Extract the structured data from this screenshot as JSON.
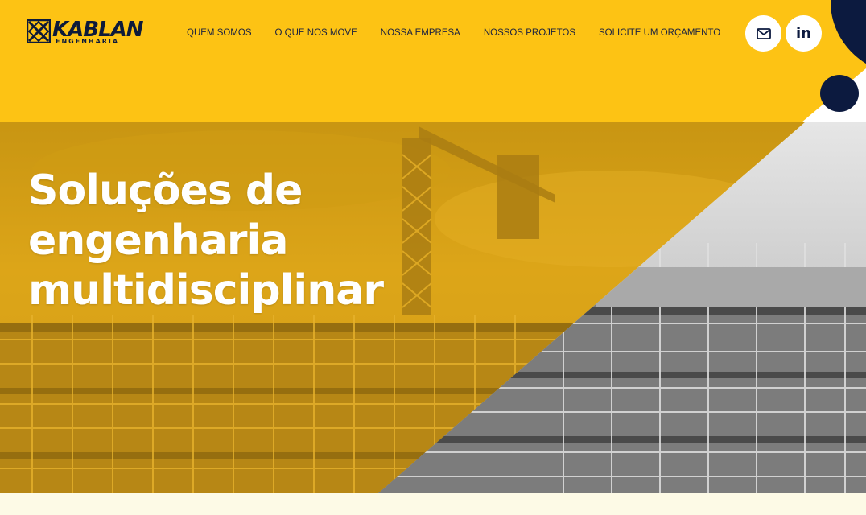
{
  "brand": {
    "name": "KABLAN",
    "tagline": "ENGENHARIA"
  },
  "nav": {
    "items": [
      "QUEM SOMOS",
      "O QUE NOS MOVE",
      "NOSSA EMPRESA",
      "NOSSOS PROJETOS",
      "SOLICITE UM ORÇAMENTO"
    ]
  },
  "social": {
    "email_icon": "envelope-icon",
    "linkedin_icon": "linkedin-icon",
    "linkedin_text": "in"
  },
  "hero": {
    "title_lines": [
      "Soluções de",
      "engenharia",
      "multidisciplinar"
    ]
  },
  "colors": {
    "brand_yellow": "#fdc314",
    "brand_navy": "#0c1a3f",
    "hero_overlay": "#e0aa18",
    "page_cream": "#fdfae6"
  }
}
